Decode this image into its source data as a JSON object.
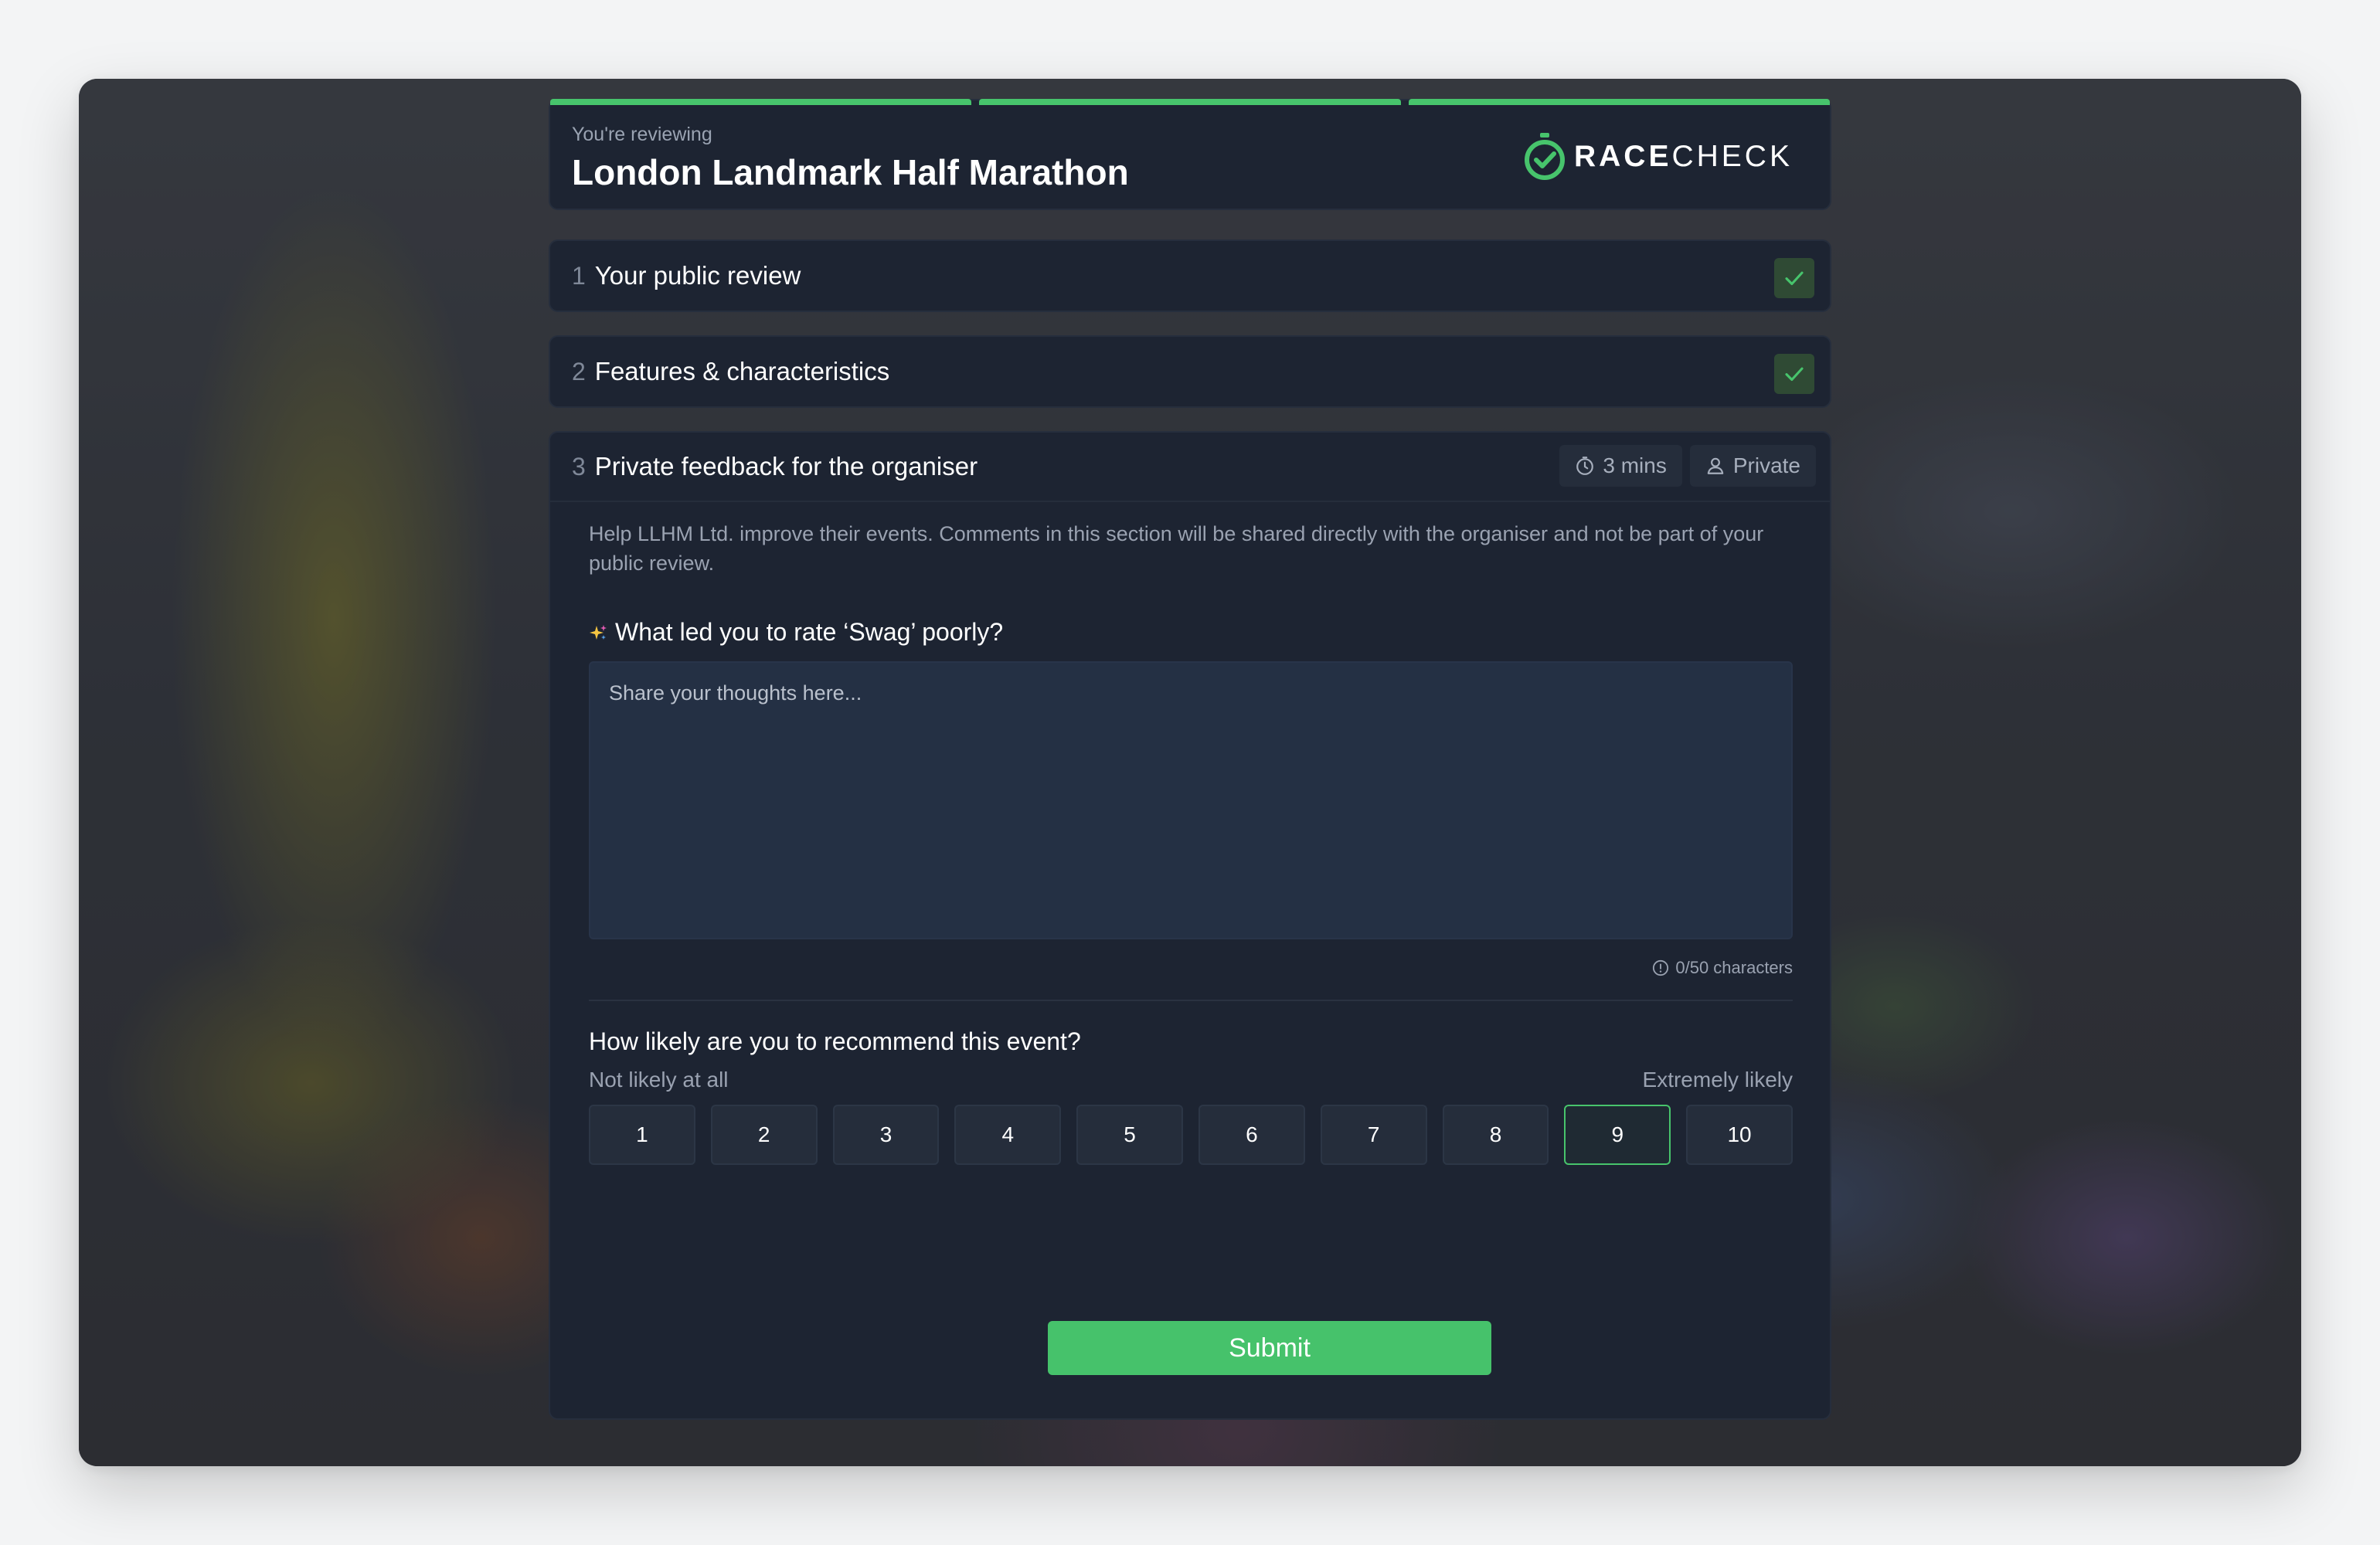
{
  "header": {
    "eyebrow": "You're reviewing",
    "title": "London Landmark Half Marathon",
    "logo_bold": "RACE",
    "logo_light": "CHECK",
    "progress_segments": 3,
    "accent_color": "#47c46c"
  },
  "sections": [
    {
      "number": "1",
      "title": "Your public review",
      "status": "complete"
    },
    {
      "number": "2",
      "title": "Features & characteristics",
      "status": "complete"
    },
    {
      "number": "3",
      "title": "Private feedback for the organiser",
      "status": "open"
    }
  ],
  "private_feedback": {
    "time_chip": "3 mins",
    "privacy_chip": "Private",
    "help_text": "Help LLHM Ltd. improve their events. Comments in this section will be shared directly with the organiser and not be part of your public review.",
    "question": "What led you to rate ‘Swag’ poorly?",
    "textarea_placeholder": "Share your thoughts here...",
    "textarea_value": "",
    "char_counter": "0/50 characters",
    "recommend_question": "How likely are you to recommend this event?",
    "scale_low_label": "Not likely at all",
    "scale_high_label": "Extremely likely",
    "scale_options": [
      "1",
      "2",
      "3",
      "4",
      "5",
      "6",
      "7",
      "8",
      "9",
      "10"
    ],
    "selected_score": "9",
    "submit_label": "Submit"
  },
  "icons": {
    "logo": "stopwatch-check-icon",
    "complete": "checkmark-icon",
    "time": "clock-icon",
    "privacy": "person-icon",
    "question": "sparkle-icon",
    "counter": "info-icon"
  }
}
